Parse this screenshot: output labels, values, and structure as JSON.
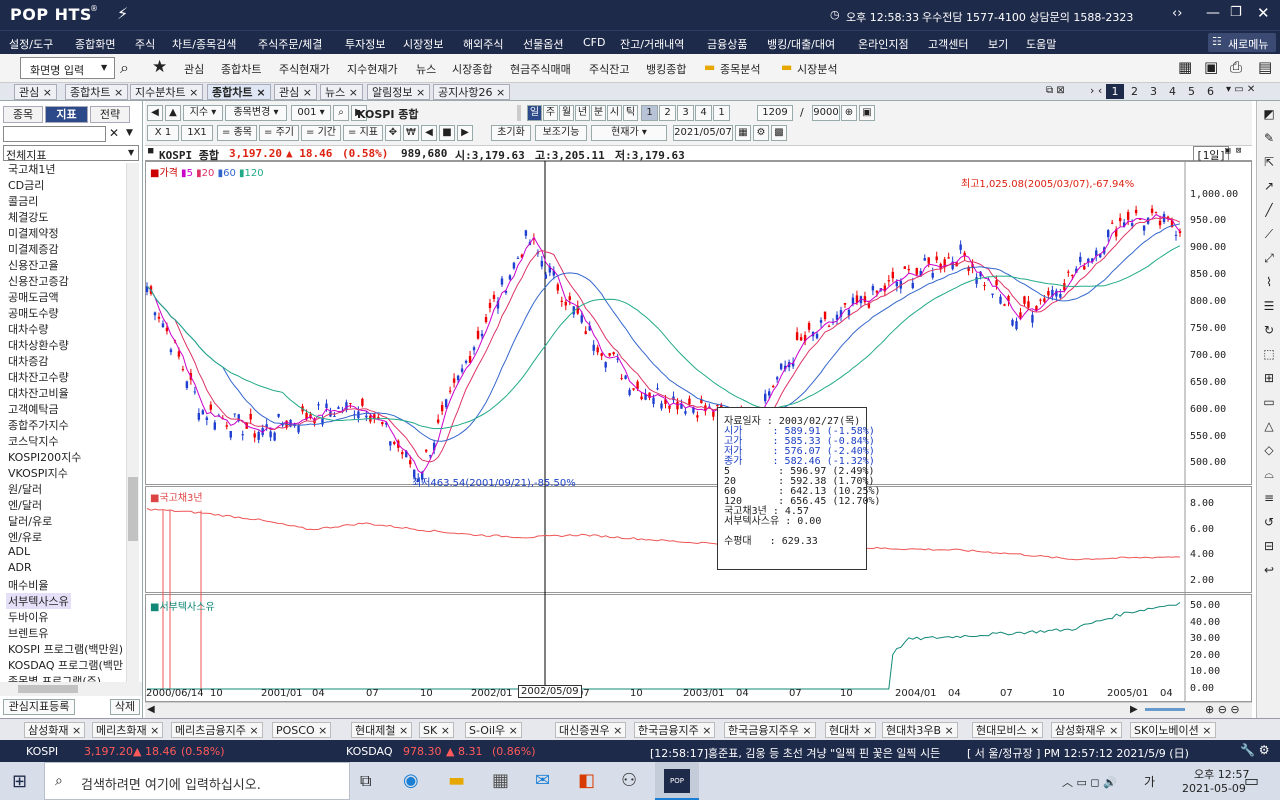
{
  "app": {
    "logo": "POP HTS",
    "logo_sup": "®",
    "time": "오후 12:58:33",
    "broker": "우수전담 1577-4100 상담문의 1588-2323"
  },
  "menu": [
    "설정/도구",
    "종합화면",
    "주식",
    "차트/종목검색",
    "주식주문/체결",
    "투자정보",
    "시장정보",
    "해외주식",
    "선물옵션",
    "CFD",
    "잔고/거래내역",
    "금융상품",
    "뱅킹/대출/대여",
    "온라인지점",
    "고객센터",
    "보기",
    "도움말"
  ],
  "menu_right": "새로메뉴",
  "toolbar": {
    "screen_input": "화면명 입력",
    "items": [
      "관심",
      "종합차트",
      "주식현재가",
      "지수현재가",
      "뉴스",
      "시장종합",
      "현금주식매매",
      "주식잔고",
      "뱅킹종합"
    ],
    "folders": [
      "종목분석",
      "시장분석"
    ]
  },
  "window_tabs": [
    "관심",
    "종합차트",
    "지수분차트",
    "종합차트",
    "관심",
    "뉴스",
    "알림정보",
    "공지사항26"
  ],
  "window_pages": [
    "1",
    "2",
    "3",
    "4",
    "5",
    "6"
  ],
  "left": {
    "tabs": [
      "종목",
      "지표",
      "전략"
    ],
    "dropdown": "전체지표",
    "items": [
      "국고채1년",
      "CD금리",
      "콜금리",
      "체결강도",
      "미결제약정",
      "미결제증감",
      "신용잔고율",
      "신용잔고증감",
      "공매도금액",
      "공매도수량",
      "대차수량",
      "대차상환수량",
      "대차증감",
      "대차잔고수량",
      "대차잔고비율",
      "고객예탁금",
      "종합주가지수",
      "코스닥지수",
      "KOSPI200지수",
      "VKOSPI지수",
      "원/달러",
      "엔/달러",
      "달러/유로",
      "엔/유로",
      "ADL",
      "ADR",
      "매수비율",
      "서부텍사스유",
      "두바이유",
      "브렌트유",
      "KOSPI 프로그램(백만원)",
      "KOSDAQ 프로그램(백만",
      "종목별 프로그램(주)"
    ],
    "highlight": "서부텍사스유",
    "bottom_btn": "관심지표등록",
    "delete_btn": "삭제"
  },
  "chartctl": {
    "index": "지수",
    "change": "종목변경",
    "code": "001",
    "name": "KOSPI 종합",
    "periods": [
      "일",
      "주",
      "월",
      "년",
      "분",
      "시",
      "틱"
    ],
    "sub": [
      "1",
      "2",
      "3",
      "4",
      "1"
    ],
    "count": "1209",
    "count2": "9000",
    "row2": [
      "X 1",
      "1X1",
      "= 종목",
      "= 주기",
      "= 기간",
      "= 지표"
    ],
    "init": "초기화",
    "aux": "보조기능",
    "price": "현재가",
    "date": "2021/05/07"
  },
  "info": {
    "name": "KOSPI 종합",
    "price": "3,197.20",
    "chg": "▲ 18.46",
    "pct": "(0.58%)",
    "vol": "989,680",
    "open": "시:3,179.63",
    "high": "고:3,205.11",
    "low": "저:3,179.63",
    "period": "1일"
  },
  "chart_data": [
    {
      "type": "line",
      "title": "KOSPI 종합",
      "legend": [
        "가격",
        "5",
        "20",
        "60",
        "120"
      ],
      "x": [
        "2000/06/14",
        "2000/10",
        "2001/01",
        "2001/04",
        "2001/07",
        "2001/10",
        "2002/01",
        "2002/04",
        "2002/07",
        "2002/10",
        "2003/01",
        "2003/04",
        "2003/07",
        "2003/10",
        "2004/01",
        "2004/04",
        "2004/07",
        "2004/10",
        "2005/01",
        "2005/04"
      ],
      "y": [
        830,
        600,
        560,
        590,
        610,
        480,
        720,
        920,
        760,
        640,
        610,
        570,
        720,
        790,
        850,
        890,
        770,
        850,
        960,
        940
      ],
      "yticks": [
        "1,000.00",
        "950.00",
        "900.00",
        "850.00",
        "800.00",
        "750.00",
        "700.00",
        "650.00",
        "600.00",
        "550.00",
        "500.00"
      ],
      "ylim": [
        460,
        1040
      ],
      "annotations": [
        "최고1,025.08(2005/03/07),-67.94%",
        "최저463.54(2001/09/21),-85.50%"
      ]
    },
    {
      "type": "line",
      "title": "국고채3년",
      "yticks": [
        "8.00",
        "6.00",
        "4.00",
        "2.00"
      ],
      "ylim": [
        1,
        9
      ],
      "y": [
        7.6,
        7.3,
        6.8,
        6.0,
        6.5,
        6.0,
        5.6,
        5.4,
        5.6,
        5.3,
        5.0,
        4.9,
        4.7,
        4.6,
        4.5,
        4.4,
        4.1,
        3.7,
        3.8,
        3.9
      ]
    },
    {
      "type": "line",
      "title": "서부텍사스유",
      "yticks": [
        "50.00",
        "40.00",
        "30.00",
        "20.00",
        "10.00",
        "0.00"
      ],
      "ylim": [
        0,
        55
      ],
      "y": [
        0,
        0,
        0,
        0,
        0,
        0,
        0,
        0,
        0,
        0,
        0,
        0,
        0,
        0,
        30,
        32,
        34,
        36,
        46,
        52
      ]
    }
  ],
  "xaxis": [
    "2000/06/14",
    "10",
    "2001/01",
    "04",
    "07",
    "10",
    "2002/01",
    "04",
    "07",
    "10",
    "2003/01",
    "04",
    "07",
    "10",
    "2004/01",
    "04",
    "07",
    "10",
    "2005/01",
    "04"
  ],
  "crosshair_label": "2002/05/09",
  "tooltip": [
    "자료일자 : 2003/02/27(목)",
    "시가     : 589.91 (-1.58%)",
    "고가     : 585.33 (-0.84%)",
    "저가     : 576.07 (-2.40%)",
    "종가     : 582.46 (-1.32%)",
    "5        : 596.97 (2.49%)",
    "20       : 592.38 (1.70%)",
    "60       : 642.13 (10.25%)",
    "120      : 656.45 (12.70%)",
    "국고채3년 : 4.57",
    "서부텍사스유 : 0.00",
    "",
    "수평대   : 629.33"
  ],
  "stocks": [
    "삼성화재",
    "메리츠화재",
    "메리츠금융지주",
    "POSCO",
    "현대제철",
    "SK",
    "S-Oil우",
    "대신증권우",
    "한국금융지주",
    "한국금융지주우",
    "현대차",
    "현대차3우B",
    "현대모비스",
    "삼성화재우",
    "SK이노베이션"
  ],
  "ticker": {
    "kospi": "KOSPI",
    "kospi_val": "3,197.20",
    "kospi_chg": "▲ 18.46",
    "kospi_pct": "(0.58%)",
    "kosdaq": "KOSDAQ",
    "kosdaq_val": "978.30",
    "kosdaq_chg": "▲ 8.31",
    "kosdaq_pct": "(0.86%)",
    "news": "[12:58:17]홍준표, 김웅 등 초선 겨냥 \"일찍 핀 꽃은 일찍 시든",
    "right": "[ 서 울/정규장 ] PM 12:57:12  2021/5/9 (日)"
  },
  "taskbar": {
    "search": "검색하려면 여기에 입력하십시오.",
    "time": "오후 12:57",
    "date": "2021-05-09",
    "lang": "가"
  }
}
